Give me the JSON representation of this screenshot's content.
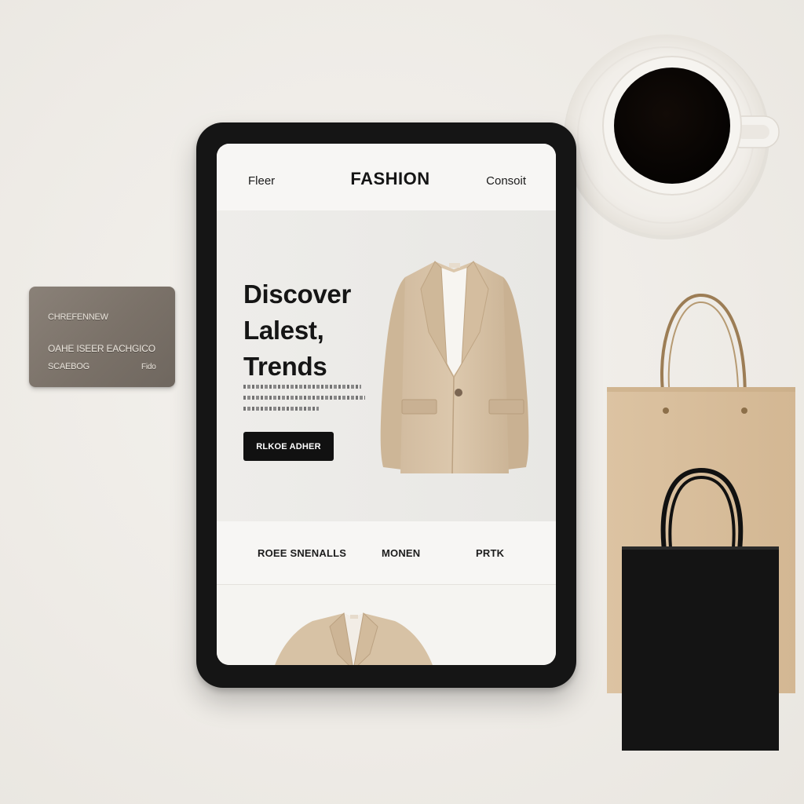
{
  "card": {
    "line1": "CHREFENNEW",
    "line2": "OAHE ISEER EACHGICO",
    "line3": "SCAEBOG",
    "line4": "Fido"
  },
  "tablet": {
    "nav": {
      "left_link": "Fleer",
      "brand": "FASHION",
      "right_link": "Consoit"
    },
    "hero": {
      "title_lines": [
        "Discover",
        "Lalest,",
        "Trends"
      ],
      "cta_label": "RLKOE ADHER",
      "image_icon": "blazer-jacket-icon"
    },
    "categories": [
      "ROEE SNENALLS",
      "MONEN",
      "PRTK"
    ],
    "preview_icon": "blazer-jacket-icon"
  },
  "props": {
    "coffee_icon": "coffee-cup-icon",
    "kraft_bag_icon": "shopping-bag-icon",
    "black_bag_icon": "shopping-bag-icon"
  },
  "colors": {
    "background": "#efece7",
    "tablet_frame": "#151515",
    "cta": "#111111",
    "jacket": "#d8c3a8",
    "kraft": "#d9bf9c",
    "card": "#7e756c"
  }
}
